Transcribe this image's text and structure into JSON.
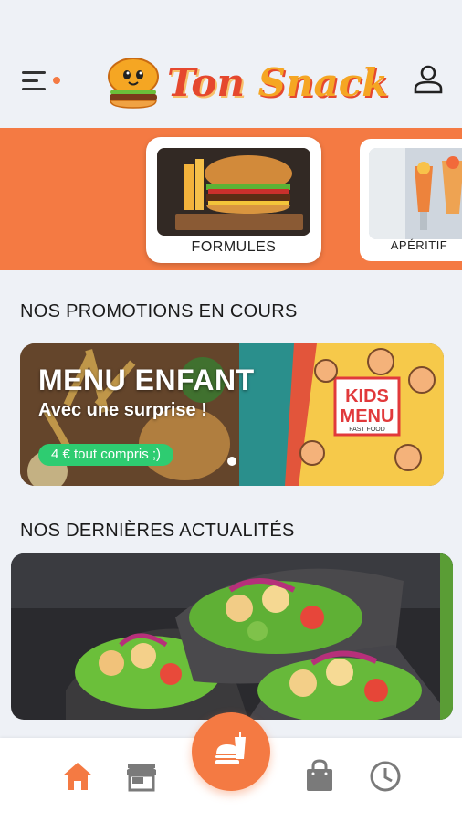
{
  "app": {
    "logo_word1": "Ton",
    "logo_word2": "Snack"
  },
  "header": {
    "menu_icon": "hamburger-menu-icon",
    "profile_icon": "user-icon",
    "notification_dot_color": "#f47a43"
  },
  "categories": [
    {
      "label": "FORMULES",
      "image": "burger-on-board"
    },
    {
      "label": "APÉRITIF",
      "image": "cocktail-drinks"
    }
  ],
  "promotions": {
    "title": "NOS PROMOTIONS EN COURS",
    "items": [
      {
        "title": "MENU ENFANT",
        "subtitle": "Avec une surprise !",
        "price": "4 € tout compris ;)",
        "badge_text": "KIDS MENU",
        "badge_sub": "FAST FOOD"
      }
    ]
  },
  "news": {
    "title": "NOS DERNIÈRES ACTUALITÉS",
    "items": [
      {
        "image": "chicken-wraps"
      }
    ]
  },
  "bottom_nav": {
    "items": [
      {
        "name": "home",
        "icon": "home-icon",
        "active": true
      },
      {
        "name": "store",
        "icon": "store-icon",
        "active": false
      },
      {
        "name": "order",
        "icon": "burger-drink-icon",
        "active": false
      },
      {
        "name": "bag",
        "icon": "shopping-bag-icon",
        "active": false
      },
      {
        "name": "history",
        "icon": "clock-icon",
        "active": false
      }
    ]
  },
  "colors": {
    "accent": "#f47a43",
    "background": "#eef1f6",
    "promo_green": "#2ecc71",
    "inactive_icon": "#7a7a7a"
  }
}
